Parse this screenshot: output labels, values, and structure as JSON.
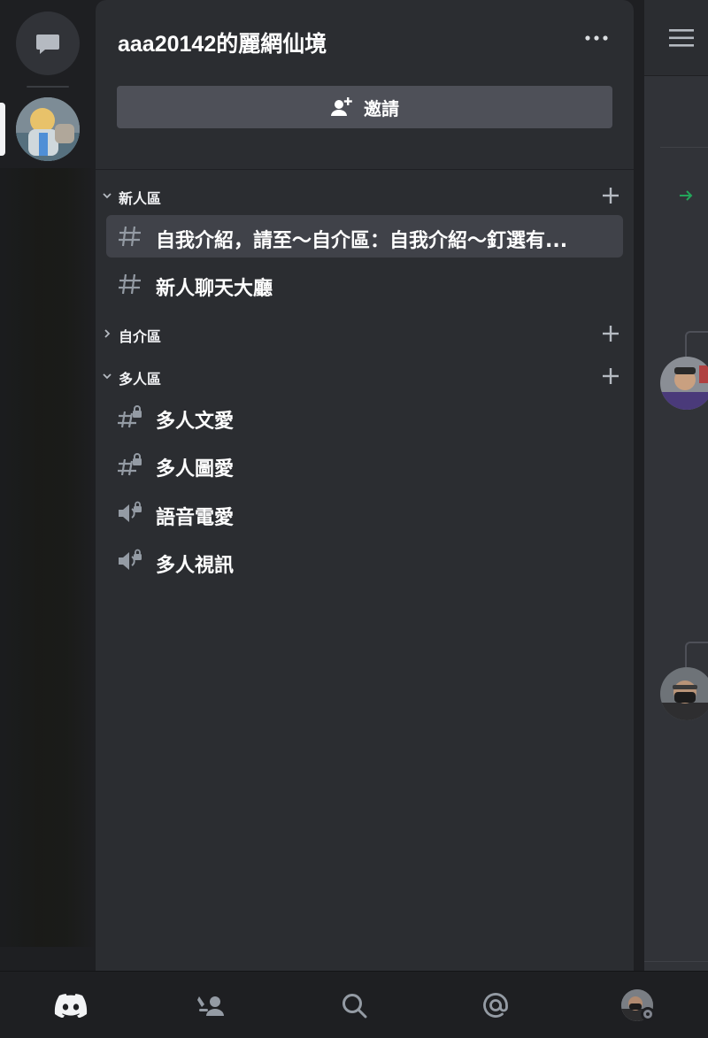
{
  "server": {
    "name": "aaa20142的麗網仙境",
    "invite_label": "邀請"
  },
  "categories": [
    {
      "name": "新人區",
      "expanded": true,
      "channels": [
        {
          "name": "自我介紹，請至～自介區：自我介紹～釘選有...",
          "type": "text",
          "active": true
        },
        {
          "name": "新人聊天大廳",
          "type": "text",
          "active": false
        }
      ]
    },
    {
      "name": "自介區",
      "expanded": false,
      "channels": []
    },
    {
      "name": "多人區",
      "expanded": true,
      "channels": [
        {
          "name": "多人文愛",
          "type": "text-locked",
          "active": false
        },
        {
          "name": "多人圖愛",
          "type": "text-locked",
          "active": false
        },
        {
          "name": "語音電愛",
          "type": "voice-locked",
          "active": false
        },
        {
          "name": "多人視訊",
          "type": "voice-locked",
          "active": false
        }
      ]
    }
  ],
  "bottom_nav": [
    "home-icon",
    "friends-icon",
    "search-icon",
    "mentions-icon",
    "profile-avatar"
  ],
  "colors": {
    "background": "#1e1f22",
    "panel": "#2b2d31",
    "active_channel": "#404249",
    "invite_button": "#4e5058",
    "text": "#ffffff",
    "muted_icon": "#949ba4",
    "green_arrow": "#23a55a"
  }
}
